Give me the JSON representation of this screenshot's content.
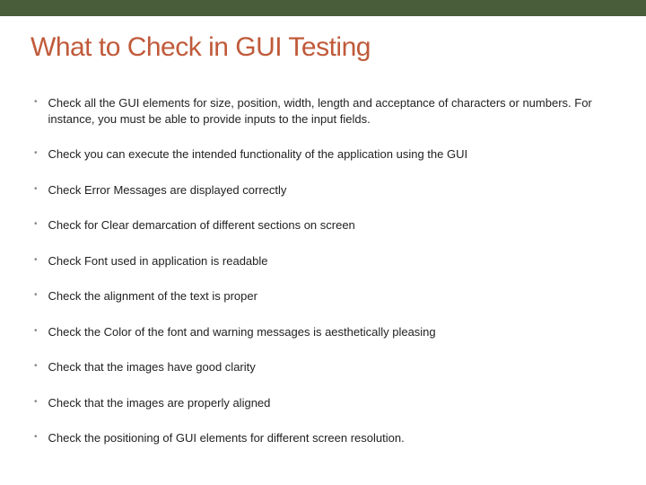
{
  "title": "What to Check in GUI Testing",
  "bullets": [
    "Check all the GUI elements for size, position, width, length and acceptance of characters or numbers. For instance, you must be able to provide inputs to the input fields.",
    "Check you can execute the intended functionality of the application using the GUI",
    "Check Error Messages are displayed correctly",
    "Check for Clear demarcation of different sections on screen",
    "Check Font used in application is readable",
    "Check the alignment of the text is proper",
    "Check the Color of the font and warning messages is aesthetically pleasing",
    "Check that the images have good clarity",
    "Check that the images are properly aligned",
    "Check the positioning of GUI elements for different screen resolution."
  ]
}
